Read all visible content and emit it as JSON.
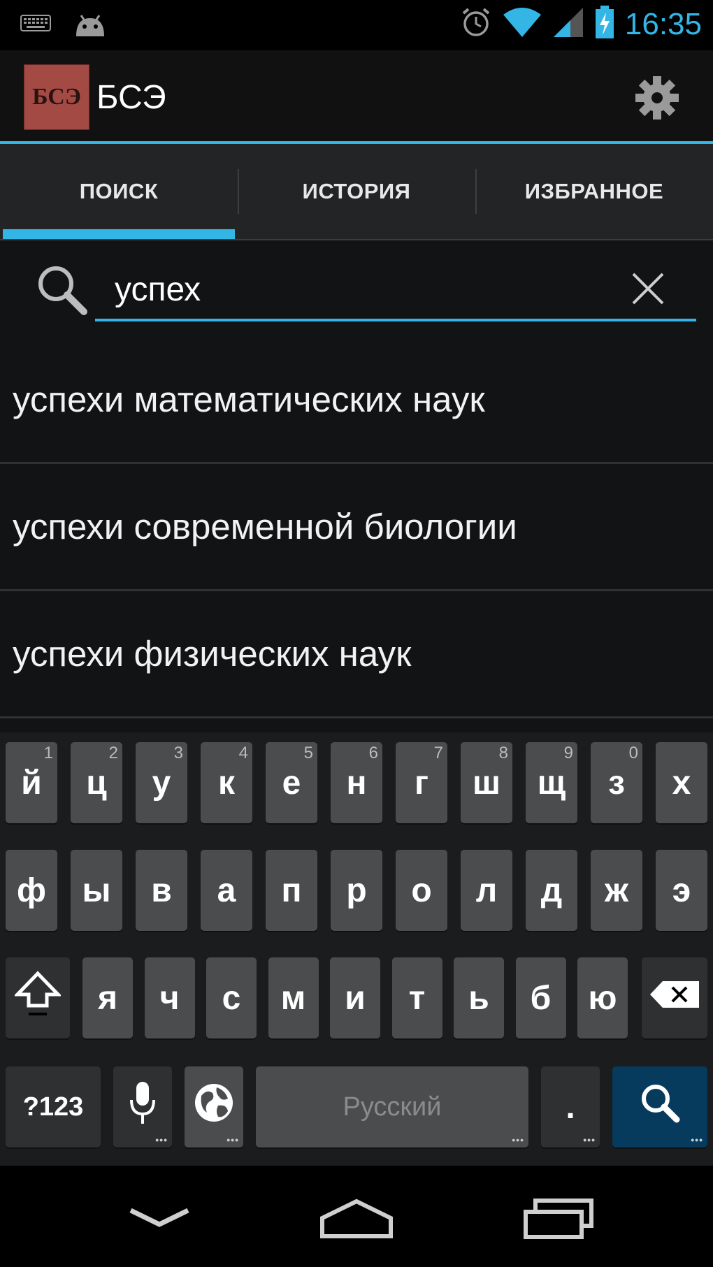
{
  "status_bar": {
    "time": "16:35",
    "icons": [
      "keyboard-icon",
      "android-icon",
      "alarm-icon",
      "wifi-icon",
      "signal-icon",
      "battery-charging-icon"
    ],
    "accent": "#33b5e5"
  },
  "action_bar": {
    "logo_text": "БСЭ",
    "title": "БСЭ",
    "settings_icon": "gear-icon"
  },
  "tabs": [
    {
      "label": "ПОИСК",
      "active": true
    },
    {
      "label": "ИСТОРИЯ",
      "active": false
    },
    {
      "label": "ИЗБРАННОЕ",
      "active": false
    }
  ],
  "search": {
    "value": "успех",
    "placeholder": ""
  },
  "results": [
    "успехи математических наук",
    "успехи современной биологии",
    "успехи физических наук"
  ],
  "keyboard": {
    "row1": [
      {
        "k": "й",
        "h": "1"
      },
      {
        "k": "ц",
        "h": "2"
      },
      {
        "k": "у",
        "h": "3"
      },
      {
        "k": "к",
        "h": "4"
      },
      {
        "k": "е",
        "h": "5"
      },
      {
        "k": "н",
        "h": "6"
      },
      {
        "k": "г",
        "h": "7"
      },
      {
        "k": "ш",
        "h": "8"
      },
      {
        "k": "щ",
        "h": "9"
      },
      {
        "k": "з",
        "h": "0"
      },
      {
        "k": "х",
        "h": ""
      }
    ],
    "row2": [
      "ф",
      "ы",
      "в",
      "а",
      "п",
      "р",
      "о",
      "л",
      "д",
      "ж",
      "э"
    ],
    "row3": [
      "я",
      "ч",
      "с",
      "м",
      "и",
      "т",
      "ь",
      "б",
      "ю"
    ],
    "symbols_label": "?123",
    "space_label": "Русский",
    "period_label": "."
  }
}
